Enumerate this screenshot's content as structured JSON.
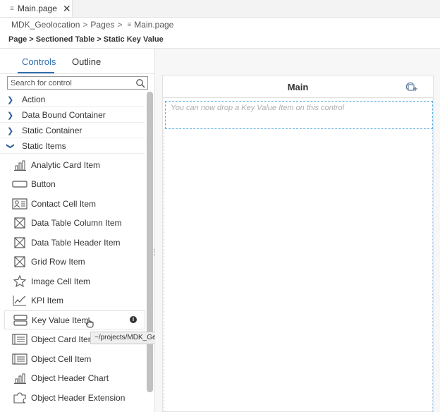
{
  "tab": {
    "title": "Main.page",
    "close": "✕"
  },
  "breadcrumb": {
    "project": "MDK_Geolocation",
    "folder": "Pages",
    "file": "Main.page",
    "sep": ">"
  },
  "path": {
    "p1": "Page",
    "p2": "Sectioned Table",
    "p3": "Static Key Value",
    "sep": ">"
  },
  "panel": {
    "tabs": [
      "Controls",
      "Outline"
    ],
    "search_placeholder": "Search for control",
    "categories": [
      "Action",
      "Data Bound Container",
      "Static Container",
      "Static Items"
    ],
    "items": [
      {
        "label": "Analytic Card Item",
        "icon": "analytic-card-icon"
      },
      {
        "label": "Button",
        "icon": "button-icon"
      },
      {
        "label": "Contact Cell Item",
        "icon": "contact-card-icon"
      },
      {
        "label": "Data Table Column Item",
        "icon": "data-table-icon"
      },
      {
        "label": "Data Table Header Item",
        "icon": "data-table-icon"
      },
      {
        "label": "Grid Row Item",
        "icon": "grid-row-icon"
      },
      {
        "label": "Image Cell Item",
        "icon": "image-star-icon"
      },
      {
        "label": "KPI Item",
        "icon": "kpi-icon"
      },
      {
        "label": "Key Value Item",
        "icon": "key-value-icon"
      },
      {
        "label": "Object Card Item",
        "icon": "object-card-icon"
      },
      {
        "label": "Object Cell Item",
        "icon": "object-cell-icon"
      },
      {
        "label": "Object Header Chart",
        "icon": "chart-icon"
      },
      {
        "label": "Object Header Extension",
        "icon": "puzzle-icon"
      }
    ],
    "info_label": "i",
    "tooltip": "~/projects/MDK_Geolocation"
  },
  "canvas": {
    "page_title": "Main",
    "drop_hint": "You can now drop a Key Value Item on this control"
  },
  "colors": {
    "accent": "#2f6fb0",
    "dropzone": "#5aaee0"
  }
}
